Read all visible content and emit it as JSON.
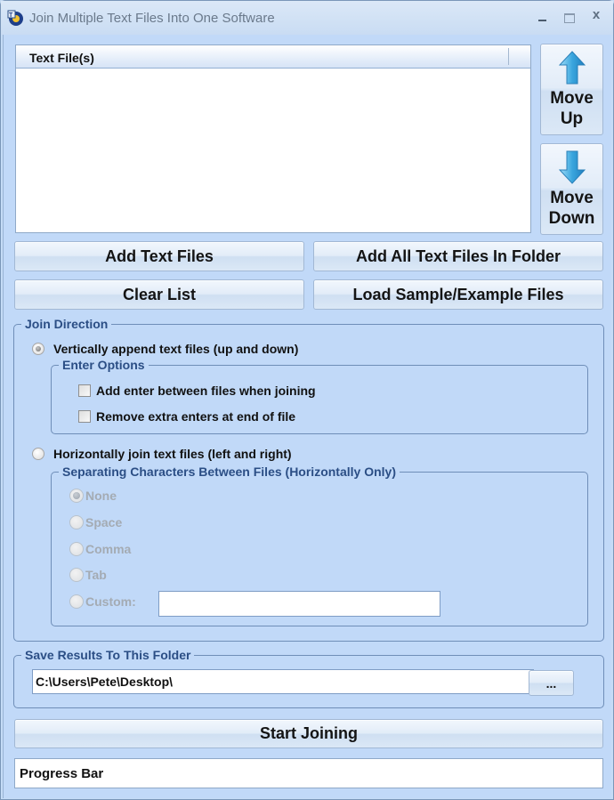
{
  "window": {
    "title": "Join Multiple Text Files Into One Software",
    "icon": "app-icon",
    "controls": {
      "minimize": "minimize-icon",
      "maximize": "maximize-icon",
      "close_label": "x"
    }
  },
  "file_list": {
    "column_header": "Text File(s)",
    "items": []
  },
  "buttons": {
    "move_up": {
      "line1": "Move",
      "line2": "Up",
      "icon": "arrow-up-icon"
    },
    "move_down": {
      "line1": "Move",
      "line2": "Down",
      "icon": "arrow-down-icon"
    },
    "add_text_files": "Add Text Files",
    "add_all_in_folder": "Add All Text Files In Folder",
    "clear_list": "Clear List",
    "load_sample": "Load Sample/Example Files",
    "browse": "...",
    "start_joining": "Start Joining"
  },
  "join_direction": {
    "legend": "Join Direction",
    "vertical": {
      "label": "Vertically append text files (up and down)",
      "checked": true
    },
    "enter_options": {
      "legend": "Enter Options",
      "add_enter": {
        "label": "Add enter between files when joining",
        "checked": false
      },
      "remove_extra": {
        "label": "Remove extra enters at end of file",
        "checked": false
      }
    },
    "horizontal": {
      "label": "Horizontally join text files (left and right)",
      "checked": false
    },
    "separating": {
      "legend": "Separating Characters Between Files (Horizontally Only)",
      "enabled": false,
      "options": [
        {
          "label": "None",
          "checked": true
        },
        {
          "label": "Space",
          "checked": false
        },
        {
          "label": "Comma",
          "checked": false
        },
        {
          "label": "Tab",
          "checked": false
        },
        {
          "label": "Custom:",
          "checked": false
        }
      ],
      "custom_value": ""
    }
  },
  "save_folder": {
    "legend": "Save Results To This Folder",
    "path": "C:\\Users\\Pete\\Desktop\\"
  },
  "progress": {
    "label": "Progress Bar",
    "value_percent": 0
  },
  "colors": {
    "window_bg": "#c1d9f8",
    "legend_text": "#2b4e85",
    "arrow": "#3aa6de"
  }
}
